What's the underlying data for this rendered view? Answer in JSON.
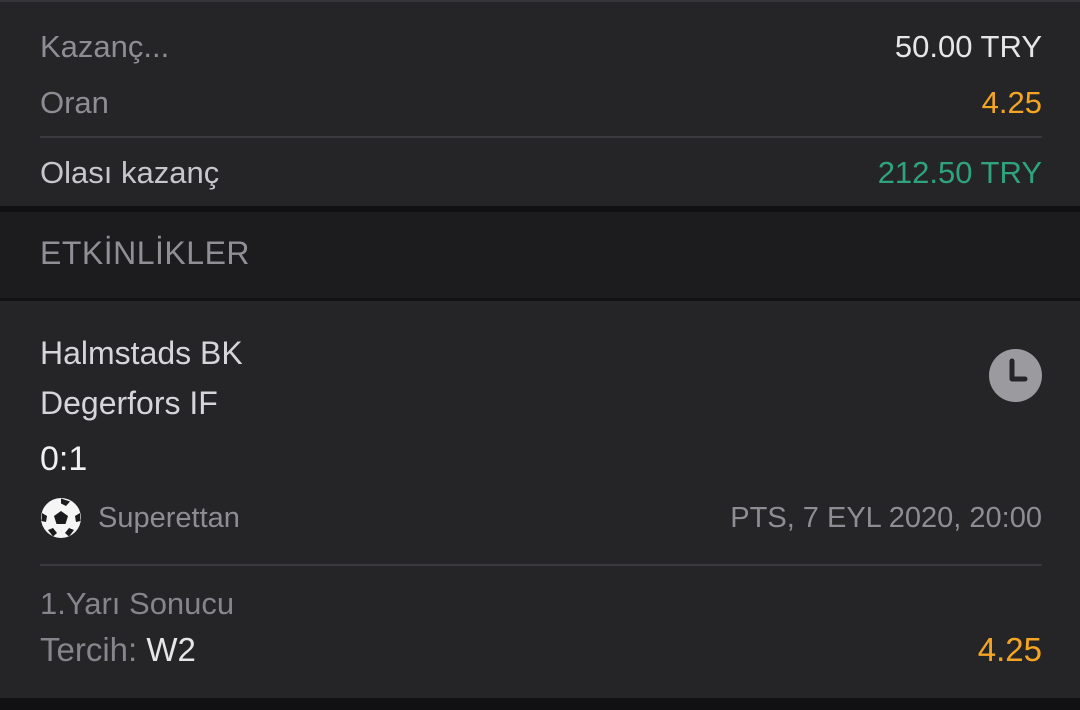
{
  "summary": {
    "stake_label": "Kazanç...",
    "stake_value": "50.00 TRY",
    "odds_label": "Oran",
    "odds_value": "4.25",
    "potential_label": "Olası kazanç",
    "potential_value": "212.50 TRY"
  },
  "events_header": {
    "title": "ETKİNLİKLER"
  },
  "event": {
    "home_team": "Halmstads BK",
    "away_team": "Degerfors IF",
    "score": "0:1",
    "league": "Superettan",
    "datetime": "PTS, 7 EYL 2020, 20:00",
    "market": "1.Yarı Sonucu",
    "pick_label": "Tercih:",
    "pick_value": "W2",
    "pick_odds": "4.25",
    "status_icon": "clock-icon",
    "sport_icon": "soccer-ball-icon"
  },
  "colors": {
    "background": "#111113",
    "card": "#252528",
    "accent_orange": "#f4a623",
    "accent_green": "#2ea37c"
  }
}
